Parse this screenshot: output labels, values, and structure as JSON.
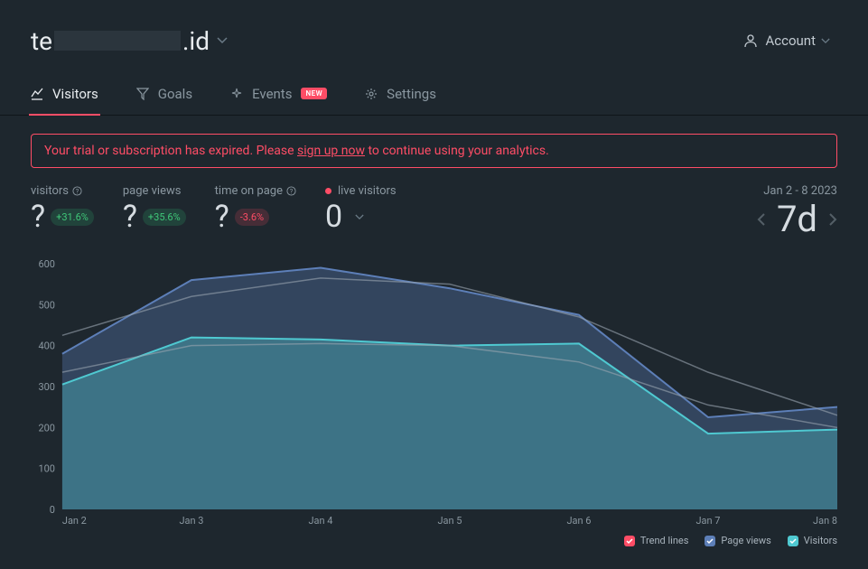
{
  "header": {
    "site_prefix": "te",
    "site_suffix": ".id",
    "account_label": "Account"
  },
  "tabs": {
    "visitors": "Visitors",
    "goals": "Goals",
    "events": "Events",
    "events_badge": "NEW",
    "settings": "Settings"
  },
  "alert": {
    "prefix": "Your trial or subscription has expired. Please ",
    "link": "sign up now",
    "suffix": " to continue using your analytics."
  },
  "stats": {
    "visitors_label": "visitors",
    "visitors_value": "?",
    "visitors_change": "+31.6%",
    "pageviews_label": "page views",
    "pageviews_value": "?",
    "pageviews_change": "+35.6%",
    "timeonpage_label": "time on page",
    "timeonpage_value": "?",
    "timeonpage_change": "-3.6%",
    "live_label": "live visitors",
    "live_value": "0"
  },
  "range": {
    "label": "Jan 2 - 8 2023",
    "value": "7d"
  },
  "chart_data": {
    "type": "area",
    "x": [
      "Jan 2",
      "Jan 3",
      "Jan 4",
      "Jan 5",
      "Jan 6",
      "Jan 7",
      "Jan 8"
    ],
    "series": [
      {
        "name": "Page views",
        "values": [
          380,
          560,
          590,
          540,
          475,
          225,
          250
        ],
        "color": "#5d7fb8"
      },
      {
        "name": "Visitors",
        "values": [
          305,
          420,
          415,
          400,
          405,
          185,
          195
        ],
        "color": "#4fc9d1"
      },
      {
        "name": "Page views trend",
        "values": [
          425,
          520,
          565,
          550,
          470,
          335,
          230
        ],
        "color": "#9aa5b0",
        "style": "line"
      },
      {
        "name": "Visitors trend",
        "values": [
          335,
          400,
          405,
          400,
          360,
          255,
          200
        ],
        "color": "#9aa5b0",
        "style": "line"
      }
    ],
    "ylim": [
      0,
      600
    ],
    "yticks": [
      0,
      100,
      200,
      300,
      400,
      500,
      600
    ],
    "xlabel": "",
    "ylabel": ""
  },
  "legend": {
    "trend": "Trend lines",
    "pageviews": "Page views",
    "visitors": "Visitors"
  }
}
